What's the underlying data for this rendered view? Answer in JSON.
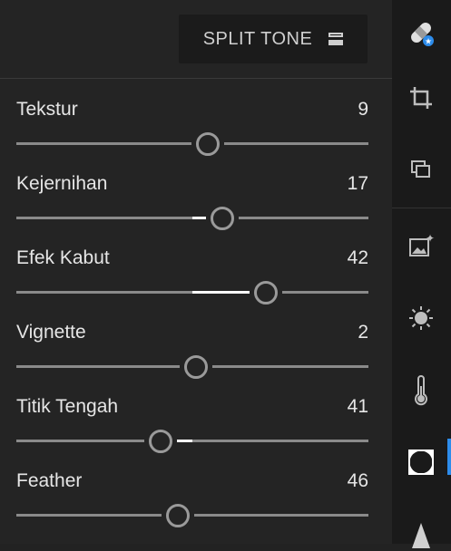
{
  "header": {
    "split_tone_label": "SPLIT TONE"
  },
  "sliders": [
    {
      "label": "Tekstur",
      "value": "9",
      "fraction": 0.545
    },
    {
      "label": "Kejernihan",
      "value": "17",
      "fraction": 0.585
    },
    {
      "label": "Efek Kabut",
      "value": "42",
      "fraction": 0.71
    },
    {
      "label": "Vignette",
      "value": "2",
      "fraction": 0.51
    },
    {
      "label": "Titik Tengah",
      "value": "41",
      "fraction": 0.41
    },
    {
      "label": "Feather",
      "value": "46",
      "fraction": 0.46
    }
  ],
  "rail": {
    "icons": [
      "healing-bandage-icon",
      "crop-rotate-icon",
      "versions-stack-icon",
      "auto-enhance-image-icon",
      "light-sun-icon",
      "color-thermometer-icon",
      "effects-vignette-icon",
      "triangle-icon"
    ],
    "active": "effects-vignette-icon",
    "accent": "#2d8ceb"
  }
}
